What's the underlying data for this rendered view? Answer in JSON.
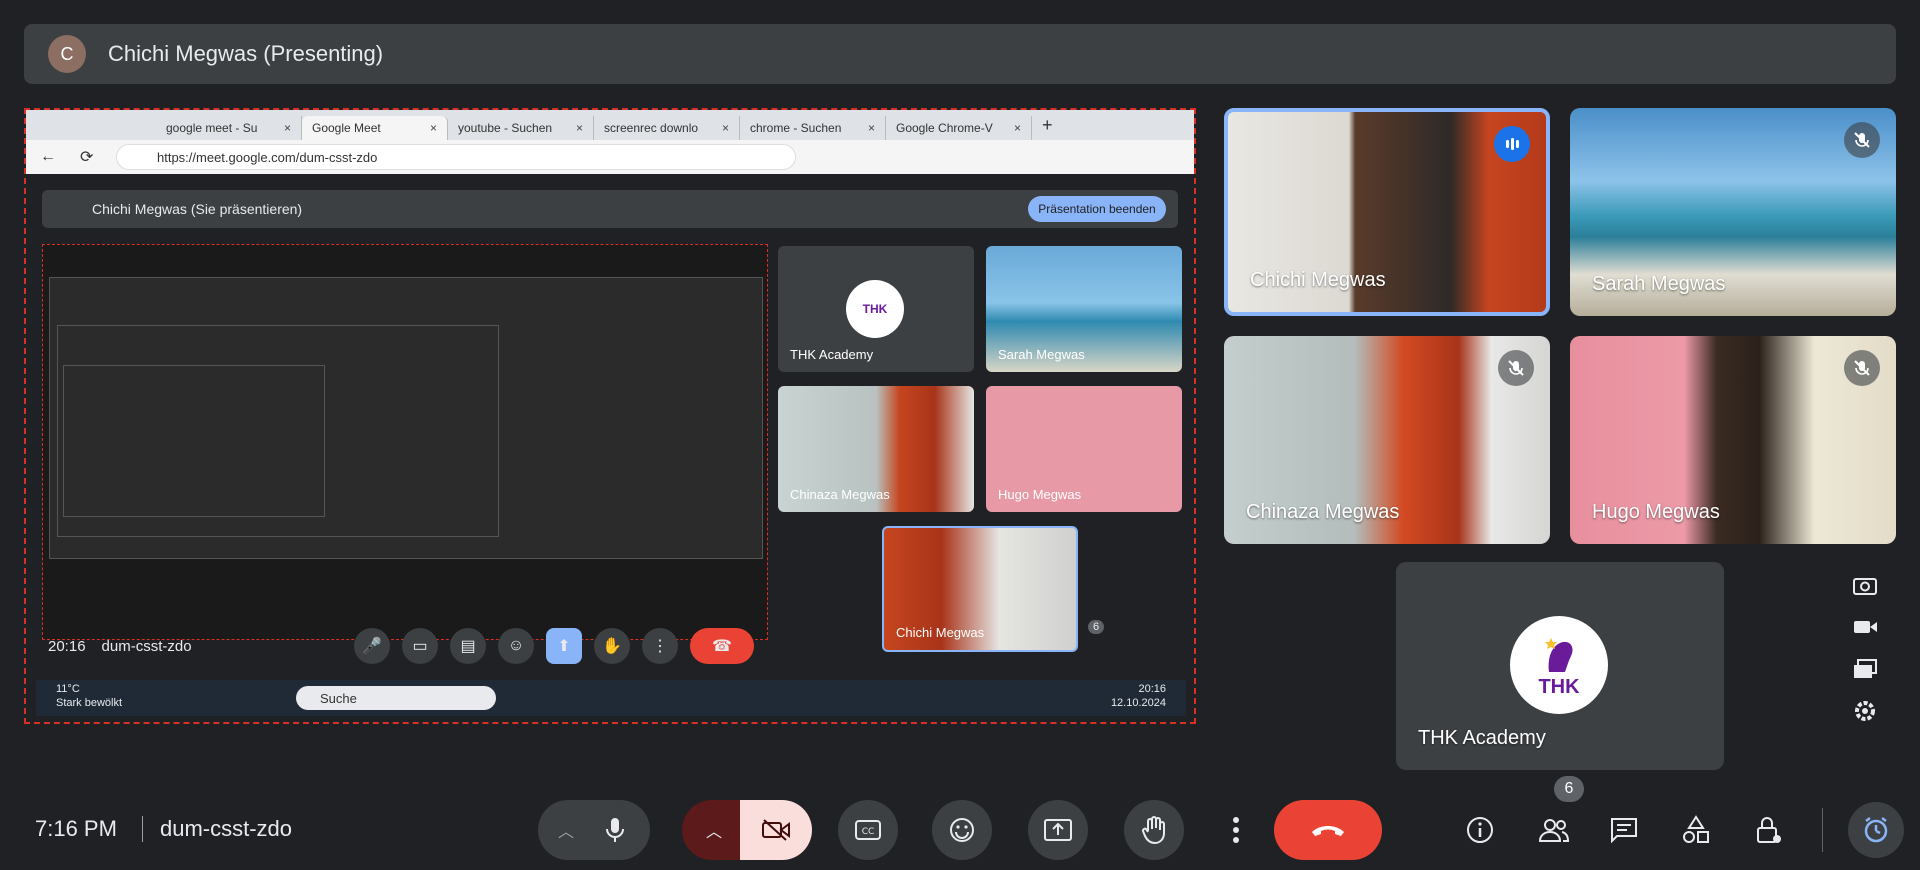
{
  "presenter": {
    "initial": "C",
    "title": "Chichi Megwas (Presenting)"
  },
  "shared_screen": {
    "tabs": [
      "google meet - Su",
      "Google Meet",
      "youtube - Suchen",
      "screenrec downlo",
      "chrome - Suchen",
      "Google Chrome-V"
    ],
    "url": "https://meet.google.com/dum-csst-zdo",
    "inner_title": "Chichi Megwas (Sie präsentieren)",
    "stop_label": "Präsentation beenden",
    "tiles": {
      "thk": "THK Academy",
      "sarah": "Sarah Megwas",
      "chinaza": "Chinaza Megwas",
      "hugo": "Hugo Megwas",
      "chichi": "Chichi Megwas"
    },
    "inner_time": "20:16",
    "inner_code": "dum-csst-zdo",
    "inner_people_count": "6",
    "weather_temp": "11°C",
    "weather_desc": "Stark bewölkt",
    "search_label": "Suche",
    "clock_time": "20:16",
    "clock_date": "12.10.2024"
  },
  "participants": [
    {
      "name": "Chichi Megwas",
      "status": "speaking"
    },
    {
      "name": "Sarah Megwas",
      "status": "muted"
    },
    {
      "name": "Chinaza Megwas",
      "status": "muted"
    },
    {
      "name": "Hugo Megwas",
      "status": "muted"
    },
    {
      "name": "THK Academy",
      "status": "logo"
    }
  ],
  "logo_text": "THK",
  "bottom": {
    "time": "7:16 PM",
    "code": "dum-csst-zdo",
    "people_count": "6"
  },
  "colors": {
    "accent": "#8ab4f8",
    "end_call": "#ea4335",
    "camera_off": "#f9dedc",
    "speaking_border": "#8ab4f8"
  }
}
